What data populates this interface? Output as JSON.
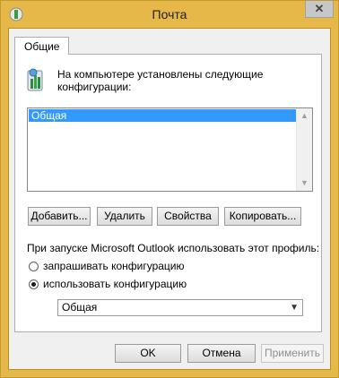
{
  "window": {
    "title": "Почта",
    "accent": "#e6b84a"
  },
  "tab": {
    "label": "Общие"
  },
  "intro": {
    "text": "На компьютере установлены следующие конфигурации:"
  },
  "profiles": {
    "items": [
      "Общая"
    ],
    "selected": "Общая"
  },
  "buttons": {
    "add": "Добавить...",
    "remove": "Удалить",
    "properties": "Свойства",
    "copy": "Копировать..."
  },
  "startup": {
    "label": "При запуске Microsoft Outlook использовать этот профиль:",
    "prompt_option": "запрашивать конфигурацию",
    "use_option": "использовать конфигурацию",
    "selected_option": "use",
    "profile_value": "Общая"
  },
  "dialog_buttons": {
    "ok": "OK",
    "cancel": "Отмена",
    "apply": "Применить"
  },
  "icons": {
    "app": "mail-app-icon",
    "close": "close-icon",
    "profile": "mail-profile-icon"
  }
}
